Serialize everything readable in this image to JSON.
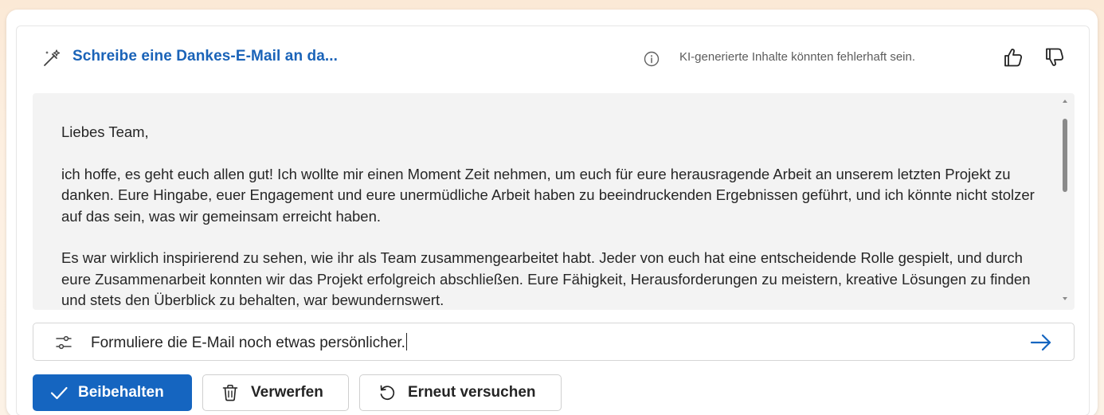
{
  "header": {
    "title": "Schreibe eine Dankes-E-Mail an da...",
    "disclaimer": "KI-generierte Inhalte könnten fehlerhaft sein.",
    "icons": [
      "wand-icon",
      "info-icon",
      "thumbs-up-icon",
      "thumbs-down-icon"
    ]
  },
  "email": {
    "greeting": "Liebes Team,",
    "paragraphs": [
      "ich hoffe, es geht euch allen gut! Ich wollte mir einen Moment Zeit nehmen, um euch für eure herausragende Arbeit an unserem letzten Projekt zu danken. Eure Hingabe, euer Engagement und eure unermüdliche Arbeit haben zu beeindruckenden Ergebnissen geführt, und ich könnte nicht stolzer auf das sein, was wir gemeinsam erreicht haben.",
      "Es war wirklich inspirierend zu sehen, wie ihr als Team zusammengearbeitet habt. Jeder von euch hat eine entscheidende Rolle gespielt, und durch eure Zusammenarbeit konnten wir das Projekt erfolgreich abschließen. Eure Fähigkeit, Herausforderungen zu meistern, kreative Lösungen zu finden und stets den Überblick zu behalten, war bewundernswert."
    ]
  },
  "prompt": {
    "value": "Formuliere die E-Mail noch etwas persönlicher."
  },
  "actions": {
    "keep_label": "Beibehalten",
    "discard_label": "Verwerfen",
    "retry_label": "Erneut versuchen"
  },
  "colors": {
    "accent": "#1565c0",
    "title": "#1a63b8",
    "text_area_bg": "#f3f3f3",
    "page_bg": "#fbe9d6"
  }
}
